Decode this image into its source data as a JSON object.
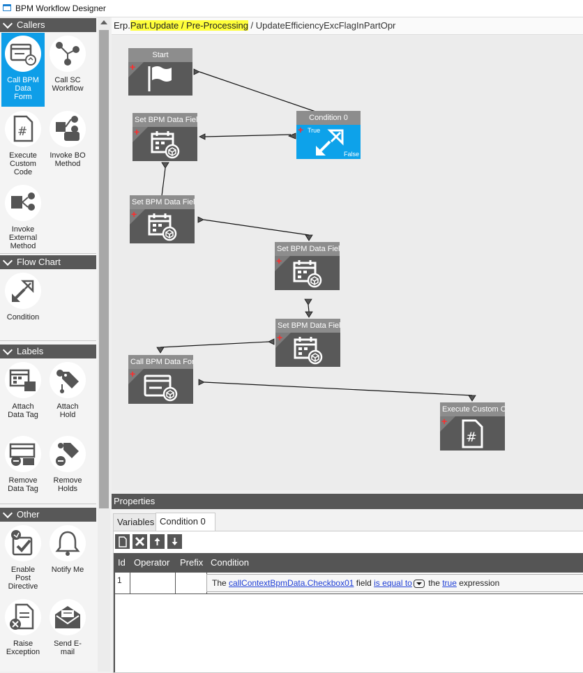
{
  "window": {
    "title": "BPM Workflow Designer"
  },
  "toolbox": {
    "categories": [
      {
        "label": "Callers",
        "tools": [
          "Call BPM Data Form",
          "Call SC Workflow",
          "Execute Custom Code",
          "Invoke BO Method",
          "Invoke External Method"
        ]
      },
      {
        "label": "Flow Chart",
        "tools": [
          "Condition"
        ]
      },
      {
        "label": "Labels",
        "tools": [
          "Attach Data Tag",
          "Attach Hold",
          "Remove Data Tag",
          "Remove Holds"
        ]
      },
      {
        "label": "Other",
        "tools": [
          "Enable Post Directive",
          "Notify Me",
          "Raise Exception",
          "Send E-mail"
        ]
      }
    ],
    "selected_tool": "Call BPM Data Form"
  },
  "breadcrumb": {
    "prefix": "Erp.",
    "highlight": "Part.Update / Pre-Processing",
    "rest": " / UpdateEfficiencyExcFlagInPartOpr"
  },
  "nodes": [
    {
      "title": "Start",
      "icon": "flag-icon"
    },
    {
      "title": "Condition 0",
      "icon": "condition-icon",
      "true_label": "True",
      "false_label": "False"
    },
    {
      "title": "Set BPM Data Field",
      "icon": "set-data-field-icon"
    },
    {
      "title": "Set BPM Data Field",
      "icon": "set-data-field-icon"
    },
    {
      "title": "Set BPM Data Field",
      "icon": "set-data-field-icon"
    },
    {
      "title": "Set BPM Data Field",
      "icon": "set-data-field-icon"
    },
    {
      "title": "Call BPM Data Form",
      "icon": "data-form-icon"
    },
    {
      "title": "Execute Custom Code",
      "icon": "custom-code-icon"
    }
  ],
  "properties": {
    "header": "Properties",
    "tabs": [
      "Variables",
      "Condition 0"
    ],
    "active_tab": "Condition 0",
    "columns": [
      "Id",
      "Operator",
      "Prefix",
      "Condition"
    ],
    "rows": [
      {
        "id": "1",
        "operator": "",
        "prefix": "",
        "condition": {
          "t1": "The ",
          "field": "callContextBpmData.Checkbox01",
          "t2": " field ",
          "op": "is equal to",
          "t3": "the ",
          "value": "true",
          "t4": " expression"
        }
      }
    ]
  },
  "colors": {
    "accent": "#0e9ee8",
    "node": "#595959",
    "node_header": "#8d8d8d",
    "highlight": "#ffff3a"
  }
}
